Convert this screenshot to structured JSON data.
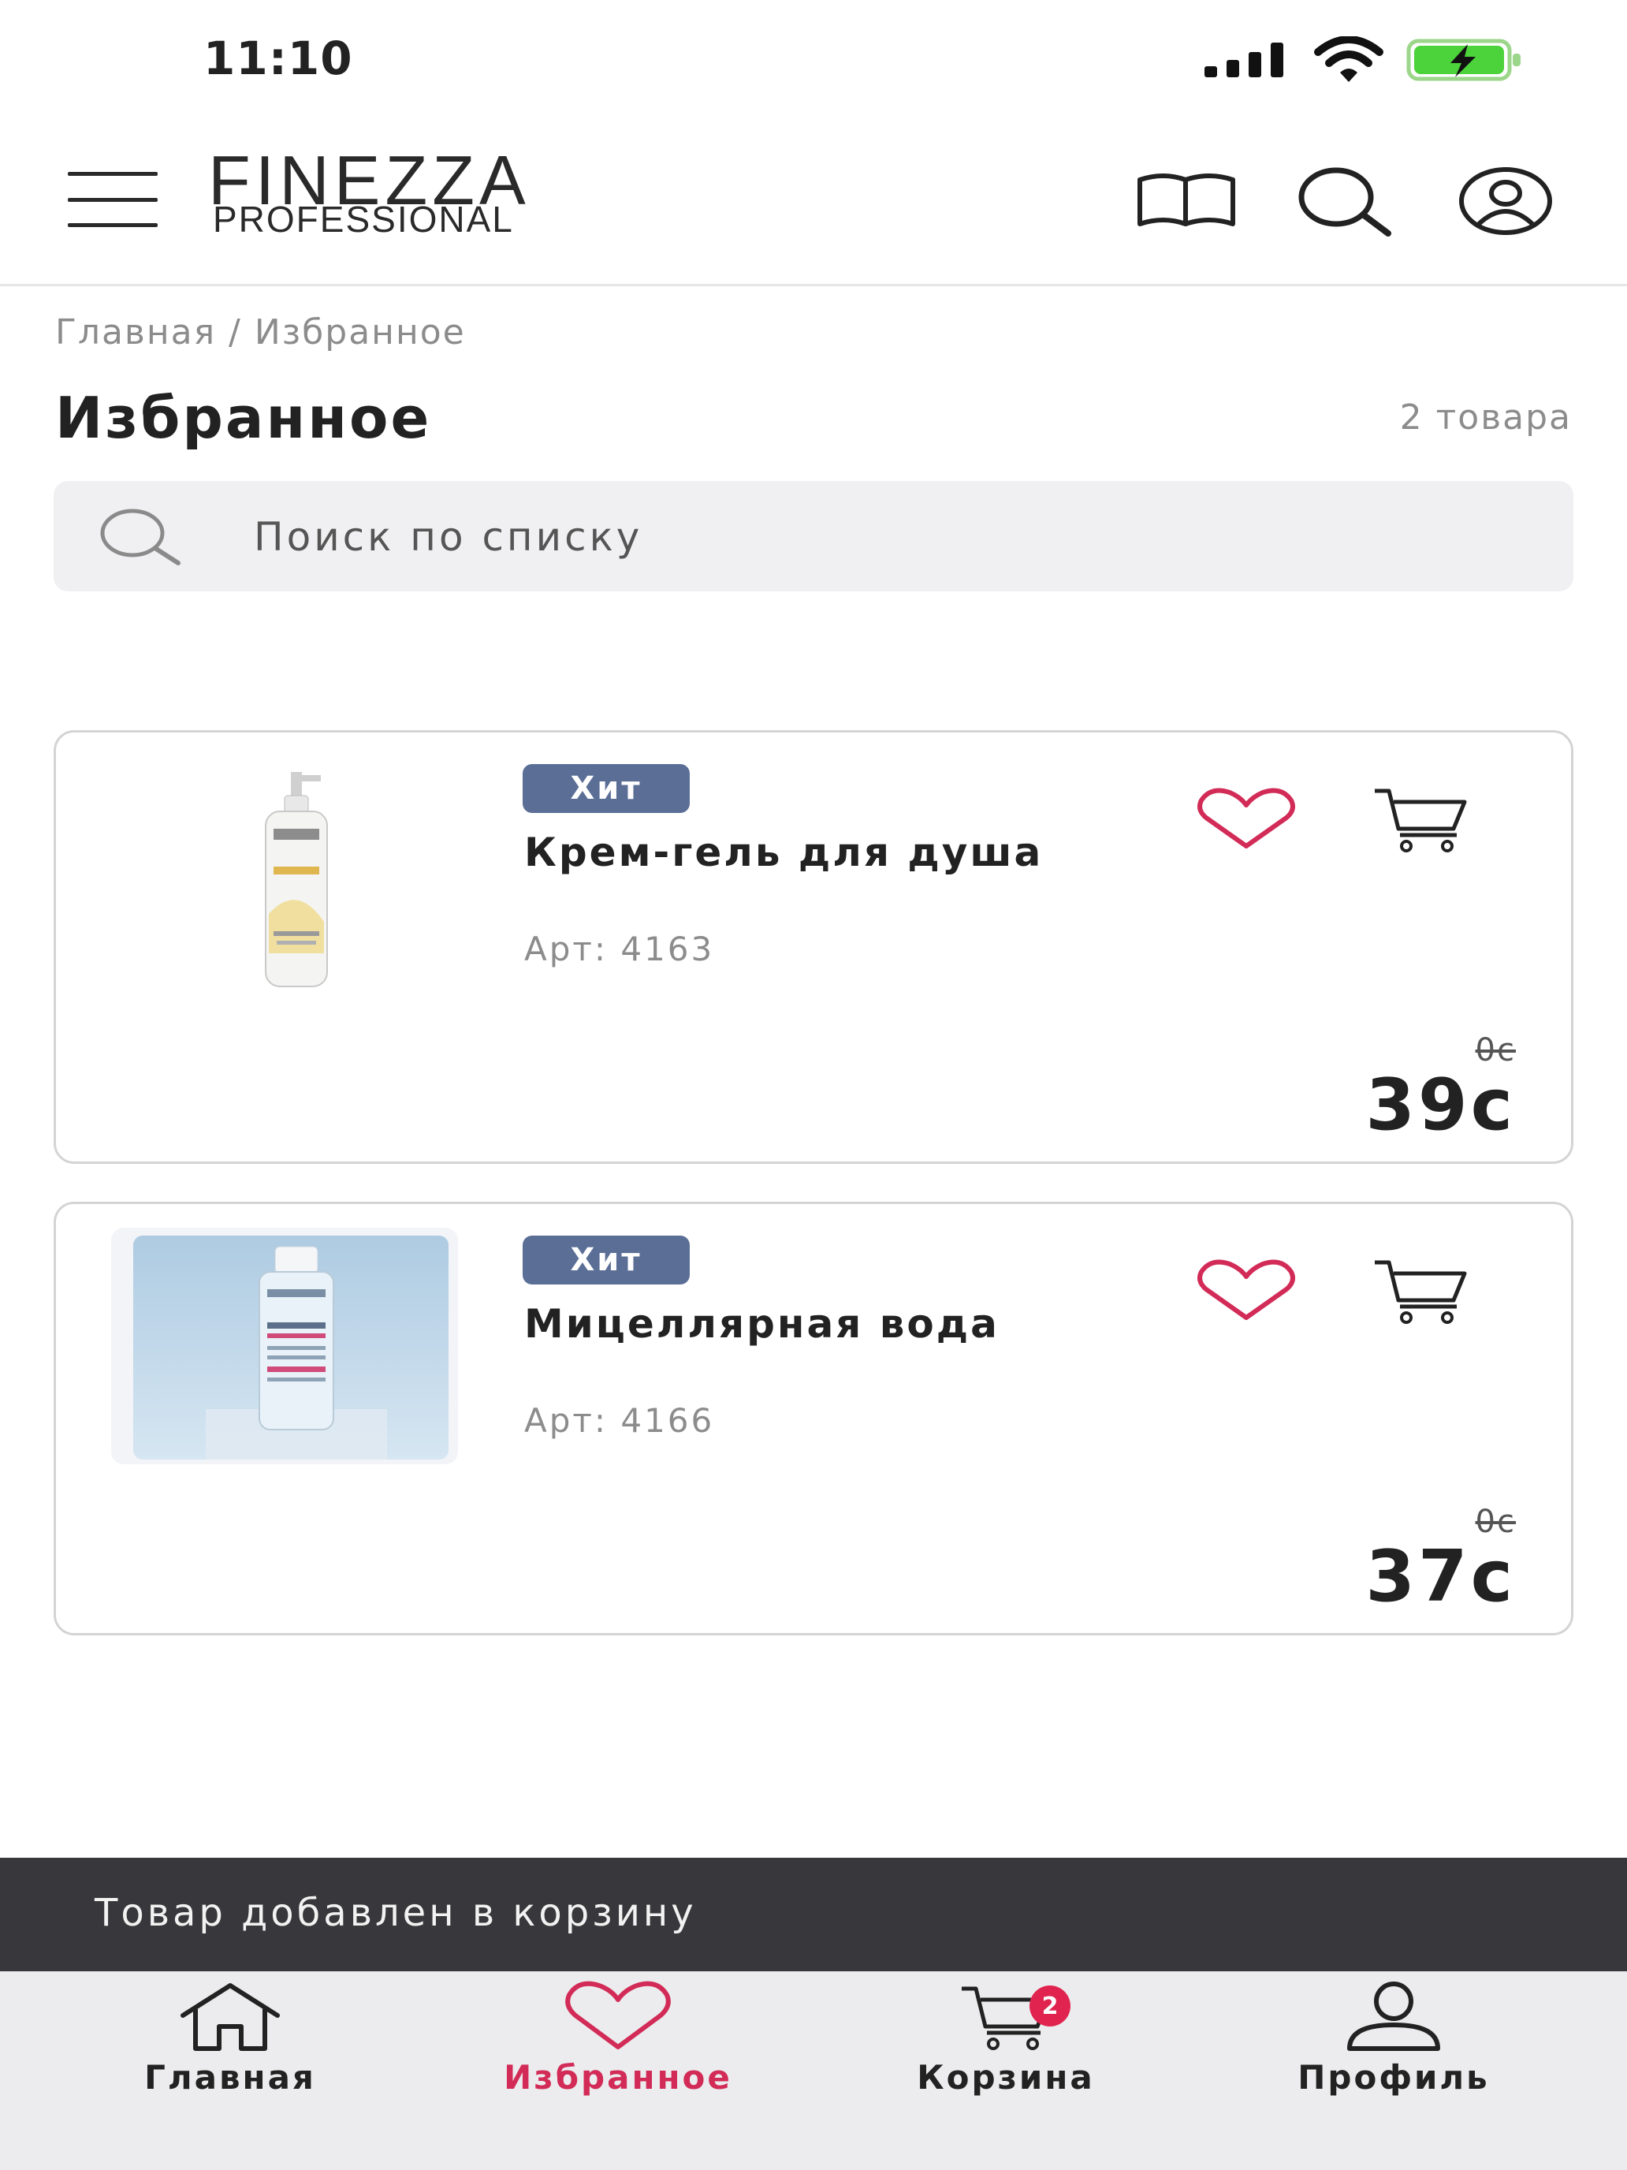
{
  "status_bar": {
    "time": "11:10"
  },
  "header": {
    "logo_top": "FINEZZA",
    "logo_bottom": "PROFESSIONAL"
  },
  "breadcrumb": "Главная / Избранное",
  "page": {
    "title": "Избранное",
    "count": "2 товара"
  },
  "search": {
    "placeholder": "Поиск по списку"
  },
  "products": [
    {
      "badge": "Хит",
      "name": "Крем-гель для душа",
      "article": "Арт: 4163",
      "old_price": "0с",
      "price": "39с"
    },
    {
      "badge": "Хит",
      "name": "Мицеллярная вода",
      "article": "Арт: 4166",
      "old_price": "0с",
      "price": "37с"
    }
  ],
  "toast": "Товар добавлен в корзину",
  "tabbar": {
    "items": [
      {
        "label": "Главная",
        "icon": "home-icon"
      },
      {
        "label": "Избранное",
        "icon": "heart-icon",
        "active": true
      },
      {
        "label": "Корзина",
        "icon": "cart-icon",
        "badge": "2"
      },
      {
        "label": "Профиль",
        "icon": "user-icon"
      }
    ]
  },
  "colors": {
    "accent": "#d22b57",
    "badge_bg": "#5a6e96",
    "toast_bg": "#38383c",
    "cart_badge": "#e0244f"
  }
}
